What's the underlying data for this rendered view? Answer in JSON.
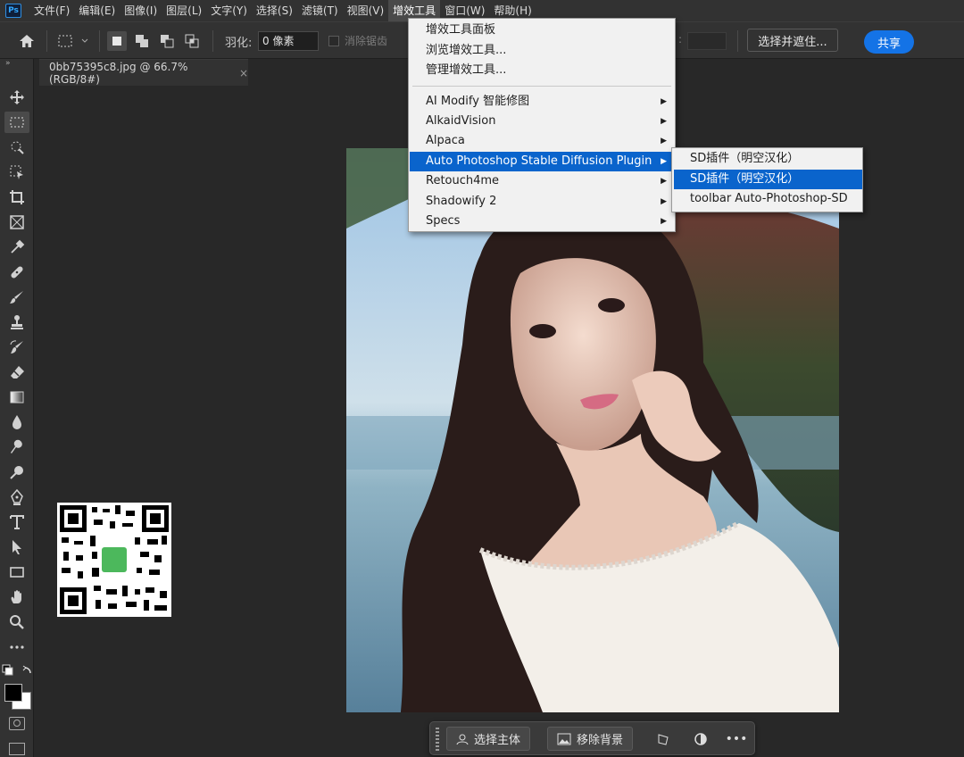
{
  "app": {
    "logo": "Ps"
  },
  "menubar": {
    "items": [
      "文件(F)",
      "编辑(E)",
      "图像(I)",
      "图层(L)",
      "文字(Y)",
      "选择(S)",
      "滤镜(T)",
      "视图(V)",
      "增效工具",
      "窗口(W)",
      "帮助(H)"
    ],
    "active": "增效工具"
  },
  "options": {
    "feather_label": "羽化:",
    "feather_value": "0 像素",
    "antialias_label": "消除锯齿",
    "select_and_mask": "选择并遮住...",
    "share": "共享"
  },
  "document": {
    "tab_title": "0bb75395c8.jpg @ 66.7%(RGB/8#)",
    "close": "×"
  },
  "plugins_menu": {
    "items": [
      "增效工具面板",
      "浏览增效工具...",
      "管理增效工具..."
    ],
    "plugins": [
      {
        "label": "AI Modify 智能修图",
        "has_submenu": true
      },
      {
        "label": "AlkaidVision",
        "has_submenu": true
      },
      {
        "label": "Alpaca",
        "has_submenu": true
      },
      {
        "label": "Auto Photoshop Stable Diffusion Plugin",
        "has_submenu": true,
        "highlighted": true
      },
      {
        "label": "Retouch4me",
        "has_submenu": true
      },
      {
        "label": "Shadowify 2",
        "has_submenu": true
      },
      {
        "label": "Specs",
        "has_submenu": true
      }
    ]
  },
  "submenu": {
    "items": [
      {
        "label": "SD插件（明空汉化）"
      },
      {
        "label": "SD插件（明空汉化）",
        "highlighted": true
      },
      {
        "label": "toolbar Auto-Photoshop-SD"
      }
    ]
  },
  "taskbar": {
    "select_subject": "选择主体",
    "remove_background": "移除背景",
    "more": "•••"
  },
  "tools": [
    "move-icon",
    "marquee-icon",
    "quick-select-icon",
    "crop-icon",
    "frame-icon",
    "eyedropper-icon",
    "healing-icon",
    "brush-icon",
    "stamp-icon",
    "history-brush-icon",
    "eraser-icon",
    "gradient-icon",
    "blur-icon",
    "dodge-icon",
    "pen-icon",
    "type-icon",
    "path-select-icon",
    "rectangle-icon",
    "hand-icon",
    "zoom-icon",
    "more-tools-icon"
  ],
  "colors": {
    "accent": "#1473e6",
    "menu_highlight": "#0a64cc",
    "panel": "#323232",
    "workspace": "#282828"
  }
}
